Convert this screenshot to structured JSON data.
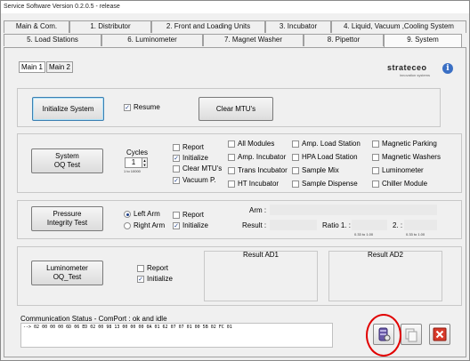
{
  "window": {
    "title": "Service Software Version 0.2.0.5 - release"
  },
  "tabs_row1": [
    "Main & Com.",
    "1. Distributor",
    "2. Front and Loading Units",
    "3. Incubator",
    "4. Liquid, Vacuum ,Cooling System"
  ],
  "tabs_row2": [
    "5. Load Stations",
    "6. Luminometer",
    "7. Magnet Washer",
    "8. Pipettor",
    "9. System"
  ],
  "subtabs": [
    "Main 1",
    "Main 2"
  ],
  "logo": {
    "text": "strateceo",
    "sub": "innovation systems"
  },
  "info_icon": "i",
  "init_section": {
    "button": "Initialize System",
    "resume_label": "Resume",
    "resume_checked": true,
    "clear_button": "Clear MTU's"
  },
  "oq_section": {
    "button": "System\nOQ Test",
    "cycles_label": "Cycles",
    "cycles_value": "1",
    "cycles_range": "1 to 10000",
    "options": [
      {
        "label": "Report",
        "checked": false
      },
      {
        "label": "Initialize",
        "checked": true
      },
      {
        "label": "Clear MTU's",
        "checked": false
      },
      {
        "label": "Vacuum P.",
        "checked": true
      }
    ],
    "modules": [
      {
        "label": "All Modules",
        "checked": false
      },
      {
        "label": "Amp. Incubator",
        "checked": false
      },
      {
        "label": "Trans Incubator",
        "checked": false
      },
      {
        "label": "HT Incubator",
        "checked": false
      },
      {
        "label": "Amp. Load Station",
        "checked": false
      },
      {
        "label": "HPA Load Station",
        "checked": false
      },
      {
        "label": "Sample Mix",
        "checked": false
      },
      {
        "label": "Sample Dispense",
        "checked": false
      },
      {
        "label": "Magnetic Parking",
        "checked": false
      },
      {
        "label": "Magnetic Washers",
        "checked": false
      },
      {
        "label": "Luminometer",
        "checked": false
      },
      {
        "label": "Chiller Module",
        "checked": false
      }
    ]
  },
  "pressure_section": {
    "button": "Pressure\nIntegrity Test",
    "left_arm": "Left Arm",
    "right_arm": "Right Arm",
    "selected_arm": "Left Arm",
    "report_label": "Report",
    "report_checked": false,
    "initialize_label": "Initialize",
    "initialize_checked": true,
    "arm_label": "Arm :",
    "result_label": "Result :",
    "ratio1_label": "Ratio 1. :",
    "ratio2_label": "2. :",
    "range1": "0.33 to 1.00",
    "range2": "0.33 to 1.00"
  },
  "luminometer_section": {
    "button": "Luminometer\nOQ_Test",
    "report_label": "Report",
    "report_checked": false,
    "initialize_label": "Initialize",
    "initialize_checked": true,
    "result1": "Result AD1",
    "result2": "Result AD2"
  },
  "status": {
    "label": "Communication Status - ComPort : ok and idle",
    "log": "--> 02 00 00 00 6D 06 ED 02 00 98 13 00 00 00 0A 01 62 07 07 01 00 5B 02 FC 01"
  },
  "bottom_icons": [
    "database-icon",
    "copy-icon",
    "close-icon"
  ],
  "colors": {
    "highlight": "#e10000",
    "check": "#1d3f8a",
    "close": "#d83a2a"
  }
}
